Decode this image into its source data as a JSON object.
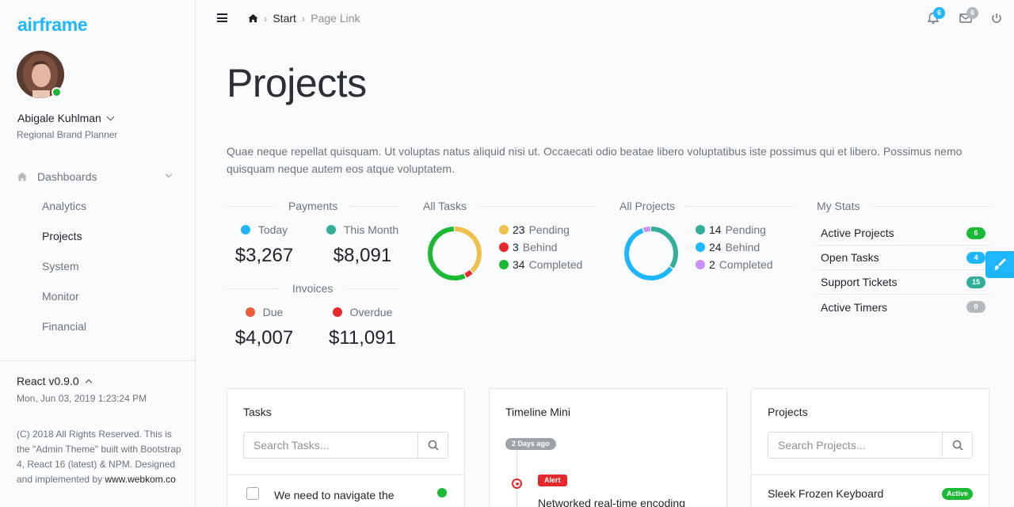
{
  "brand": "airframe",
  "user": {
    "name": "Abigale Kuhlman",
    "role": "Regional Brand Planner"
  },
  "sidebar": {
    "section": "Dashboards",
    "items": [
      {
        "label": "Analytics"
      },
      {
        "label": "Projects",
        "active": true
      },
      {
        "label": "System"
      },
      {
        "label": "Monitor"
      },
      {
        "label": "Financial"
      }
    ],
    "version": "React v0.9.0",
    "datetime": "Mon, Jun 03, 2019 1:23:24 PM",
    "copyright": "(C) 2018 All Rights Reserved. This is the \"Admin Theme\" built with Bootstrap 4, React 16 (latest) & NPM. Designed and implemented by",
    "copyright_link": "www.webkom.co"
  },
  "topbar": {
    "breadcrumb": [
      "Start",
      "Page Link"
    ],
    "notifications_count": "6",
    "messages_count": "6"
  },
  "page": {
    "title": "Projects",
    "description": "Quae neque repellat quisquam. Ut voluptas natus aliquid nisi ut. Occaecati odio beatae libero voluptatibus iste possimus qui et libero. Possimus nemo quisquam neque autem eos atque voluptatem."
  },
  "payments": {
    "label": "Payments",
    "today_label": "Today",
    "today_value": "$3,267",
    "month_label": "This Month",
    "month_value": "$8,091"
  },
  "invoices": {
    "label": "Invoices",
    "due_label": "Due",
    "due_value": "$4,007",
    "overdue_label": "Overdue",
    "overdue_value": "$11,091"
  },
  "all_tasks": {
    "label": "All Tasks",
    "segments": [
      {
        "count": "23",
        "label": "Pending",
        "color": "#f1c04a",
        "value": 23
      },
      {
        "count": "3",
        "label": "Behind",
        "color": "#e5282b",
        "value": 3
      },
      {
        "count": "34",
        "label": "Completed",
        "color": "#1bb934",
        "value": 34
      }
    ]
  },
  "all_projects": {
    "label": "All Projects",
    "segments": [
      {
        "count": "14",
        "label": "Pending",
        "color": "#33ae9a",
        "value": 14
      },
      {
        "count": "24",
        "label": "Behind",
        "color": "#1eb7ff",
        "value": 24
      },
      {
        "count": "2",
        "label": "Completed",
        "color": "#ca8eff",
        "value": 2
      }
    ]
  },
  "my_stats": {
    "label": "My Stats",
    "rows": [
      {
        "label": "Active Projects",
        "value": "6",
        "color": "#1bb934"
      },
      {
        "label": "Open Tasks",
        "value": "4",
        "color": "#1eb7ff"
      },
      {
        "label": "Support Tickets",
        "value": "15",
        "color": "#33ae9a"
      },
      {
        "label": "Active Timers",
        "value": "0",
        "color": "#b3b8bd"
      }
    ]
  },
  "cards": {
    "tasks": {
      "title": "Tasks",
      "placeholder": "Search Tasks...",
      "first_task": "We need to navigate the"
    },
    "timeline": {
      "title": "Timeline Mini",
      "date_pill": "2 Days ago",
      "alert": "Alert",
      "entry": "Networked real-time encoding"
    },
    "projects": {
      "title": "Projects",
      "placeholder": "Search Projects...",
      "first_project": "Sleek Frozen Keyboard",
      "first_status": "Active"
    }
  },
  "colors": {
    "accent": "#1eb7ff",
    "success": "#1bb934",
    "danger": "#e5282b",
    "teal": "#33ae9a",
    "warning": "#f1c04a",
    "purple": "#ca8eff",
    "muted_orange": "#ee5c37"
  }
}
